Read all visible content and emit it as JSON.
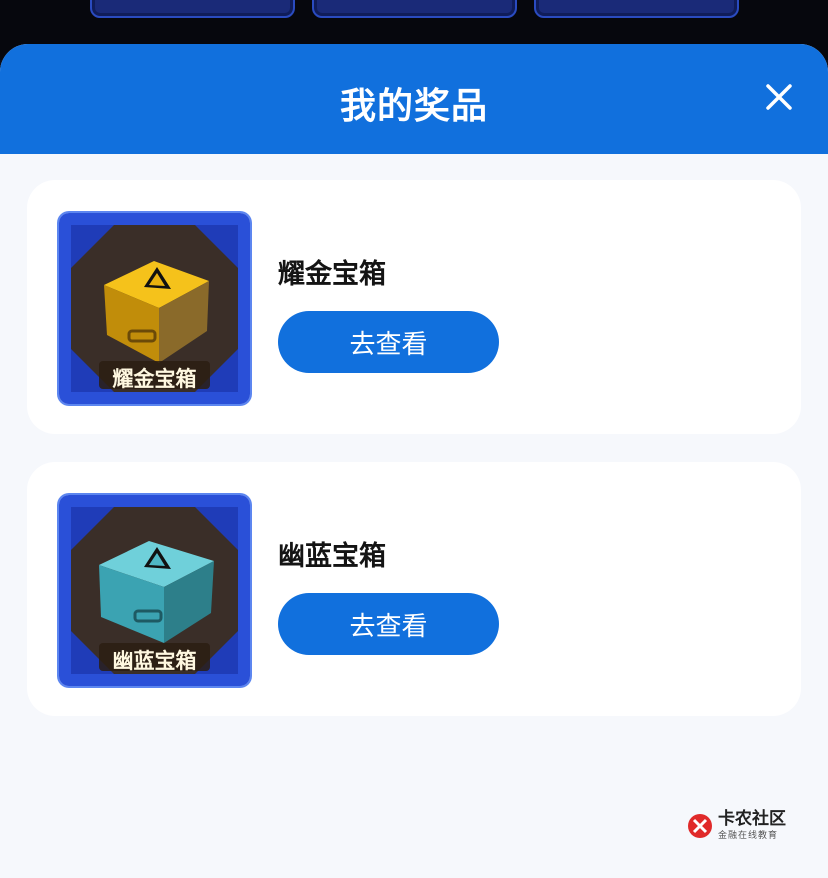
{
  "background": {
    "cards": 3
  },
  "header": {
    "title": "我的奖品",
    "close_icon": "close-icon"
  },
  "prizes": [
    {
      "name": "耀金宝箱",
      "image_label": "耀金宝箱",
      "button_label": "去查看",
      "box_color": "#e9b10f"
    },
    {
      "name": "幽蓝宝箱",
      "image_label": "幽蓝宝箱",
      "button_label": "去查看",
      "box_color": "#4fb8c6"
    }
  ],
  "watermark": {
    "main": "卡农社区",
    "sub": "金融在线教育"
  },
  "colors": {
    "accent": "#1170dd",
    "sheet_bg": "#f6f8fc"
  }
}
